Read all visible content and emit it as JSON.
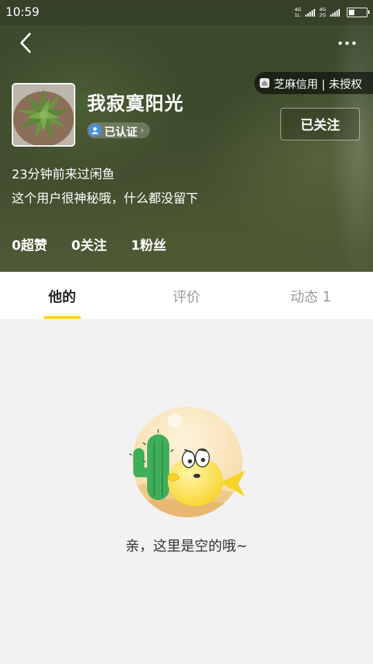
{
  "status_bar": {
    "time": "10:59",
    "network_top": "4G",
    "network_top2": "4G",
    "network_bottom": "1L",
    "network_bottom2": "2G",
    "battery_level": 0.35
  },
  "nav": {
    "back_icon": "chevron-left-icon",
    "more_icon": "more-dots-icon"
  },
  "credit": {
    "label": "芝麻信用 | 未授权",
    "icon": "sesame-credit-icon"
  },
  "profile": {
    "username": "我寂寞阳光",
    "verified_label": "已认证",
    "verified_icon": "verified-user-icon",
    "follow_button": "已关注",
    "last_active": "23分钟前来过闲鱼",
    "bio": "这个用户很神秘哦，什么都没留下",
    "avatar_icon": "succulent-avatar"
  },
  "stats": [
    {
      "label": "0超赞"
    },
    {
      "label": "0关注"
    },
    {
      "label": "1粉丝"
    }
  ],
  "tabs": [
    {
      "label": "他的",
      "active": true
    },
    {
      "label": "评价",
      "active": false
    },
    {
      "label": "动态 1",
      "active": false
    }
  ],
  "empty_state": {
    "text": "亲，这里是空的哦~",
    "illustration": "cactus-fish-illustration"
  },
  "colors": {
    "accent": "#ffd21e",
    "header_green": "#3f4b30",
    "badge_blue": "#4a90e2"
  }
}
